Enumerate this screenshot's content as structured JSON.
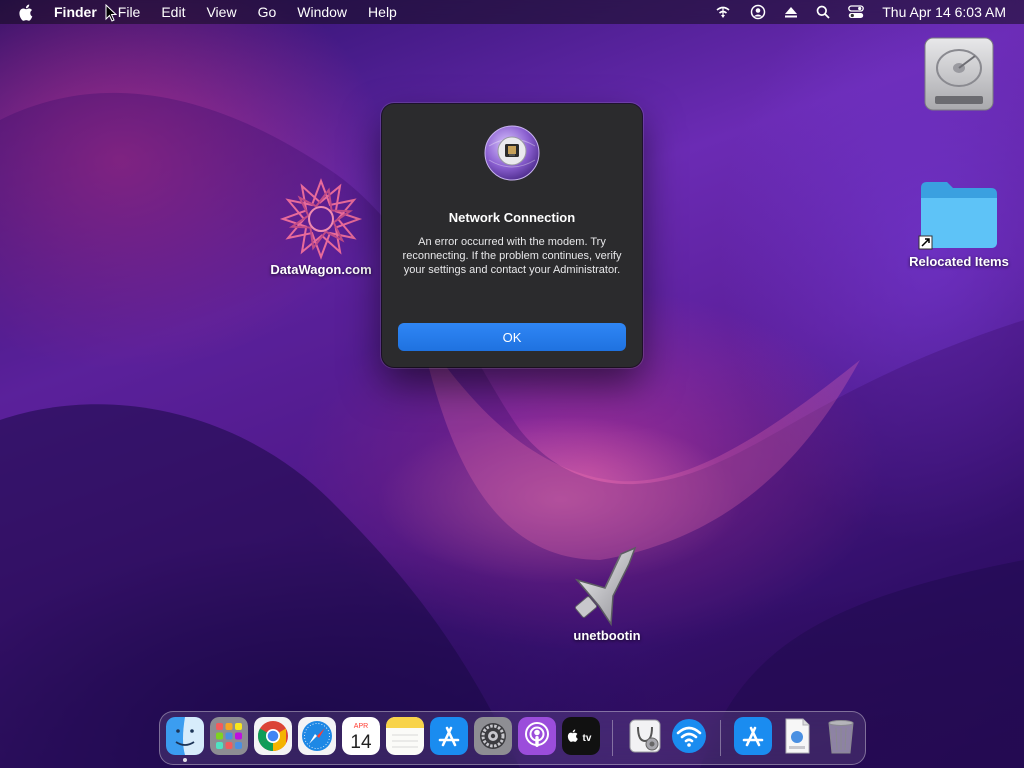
{
  "menubar": {
    "app_name": "Finder",
    "menus": [
      "File",
      "Edit",
      "View",
      "Go",
      "Window",
      "Help"
    ],
    "clock": "Thu Apr 14  6:03 AM",
    "status_icons": [
      "wifi-icon",
      "user-account-icon",
      "eject-icon",
      "spotlight-search-icon",
      "control-center-icon"
    ]
  },
  "desktop": {
    "icons": [
      {
        "label": "DataWagon.com",
        "icon": "datawagon-logo-icon"
      },
      {
        "label": "Relocated Items",
        "icon": "folder-alias-icon"
      },
      {
        "label": "unetbootin",
        "icon": "unetbootin-app-icon"
      },
      {
        "label": "",
        "icon": "hard-drive-icon"
      }
    ]
  },
  "dialog": {
    "title": "Network Connection",
    "message": "An error occurred with the modem. Try reconnecting. If the problem continues, verify your settings and contact your Administrator.",
    "ok_label": "OK",
    "icon": "network-connection-icon"
  },
  "dock": {
    "apps": [
      "Finder",
      "Launchpad",
      "Google Chrome",
      "Safari",
      "Calendar",
      "Notes",
      "App Store",
      "System Preferences",
      "Podcasts",
      "Apple TV",
      "Directory Utility",
      "Wireless Diagnostics",
      "App Store",
      "Document",
      "Trash"
    ],
    "calendar_month": "APR",
    "calendar_day": "14",
    "tv_label": "tv"
  }
}
